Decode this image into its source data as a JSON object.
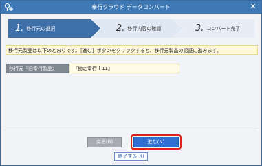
{
  "window": {
    "title": "奉行クラウド データコンバート",
    "close_glyph": "✕"
  },
  "steps": [
    {
      "number": "1.",
      "label": "移行元の選択",
      "state": "active"
    },
    {
      "number": "2.",
      "label": "移行内容の確認",
      "state": "inactive"
    },
    {
      "number": "3.",
      "label": "コンバート完了",
      "state": "inactive"
    }
  ],
  "notice": {
    "text": "移行元製品は以下のとおりです。［進む］ボタンをクリックすると、移行元製品の認証に進みます。"
  },
  "source": {
    "label": "移行元『旧奉行製品』",
    "value": "『勘定奉行ｉ11』"
  },
  "buttons": {
    "back": "戻る(B)",
    "next": "進む(N)",
    "exit": "終了する(X)"
  },
  "colors": {
    "titlebar": "#3e78b5",
    "step_active": "#3e6fa8",
    "step_inactive": "#dfe8f3",
    "highlight": "#e0201b",
    "primary_button": "#2f6fd0"
  },
  "icons": {
    "app": "key-plus-icon",
    "close": "close-icon"
  }
}
